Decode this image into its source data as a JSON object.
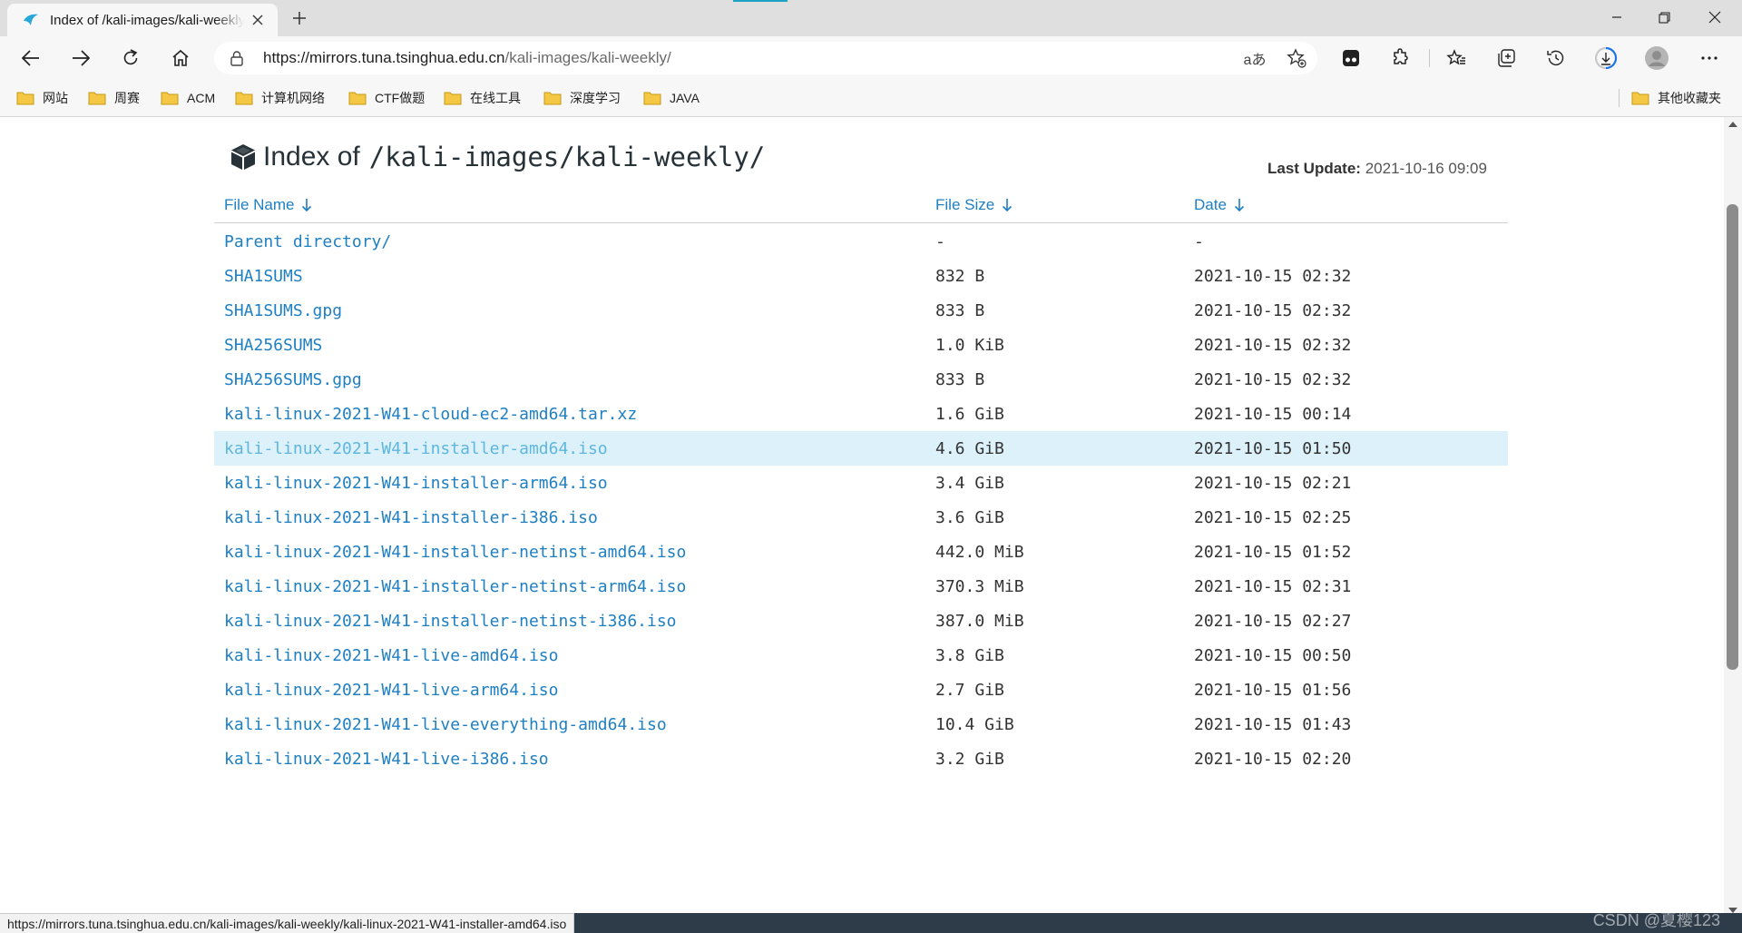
{
  "browser": {
    "tab": {
      "title": "Index of /kali-images/kali-weekly/"
    },
    "address": {
      "host": "https://mirrors.tuna.tsinghua.edu.cn",
      "path": "/kali-images/kali-weekly/"
    },
    "read_aloud_label": "aあ"
  },
  "bookmarks": {
    "items": [
      "网站",
      "周赛",
      "ACM",
      "计算机网络",
      "CTF做题",
      "在线工具",
      "深度学习",
      "JAVA"
    ],
    "other": "其他收藏夹"
  },
  "page": {
    "heading_prefix": "Index of",
    "heading_path": "/kali-images/kali-weekly/",
    "last_update_label": "Last Update:",
    "last_update_value": "2021-10-16 09:09",
    "columns": {
      "name": "File Name",
      "size": "File Size",
      "date": "Date"
    },
    "rows": [
      {
        "name": "Parent directory/",
        "size": "-",
        "date": "-"
      },
      {
        "name": "SHA1SUMS",
        "size": "832 B",
        "date": "2021-10-15 02:32"
      },
      {
        "name": "SHA1SUMS.gpg",
        "size": "833 B",
        "date": "2021-10-15 02:32"
      },
      {
        "name": "SHA256SUMS",
        "size": "1.0 KiB",
        "date": "2021-10-15 02:32"
      },
      {
        "name": "SHA256SUMS.gpg",
        "size": "833 B",
        "date": "2021-10-15 02:32"
      },
      {
        "name": "kali-linux-2021-W41-cloud-ec2-amd64.tar.xz",
        "size": "1.6 GiB",
        "date": "2021-10-15 00:14"
      },
      {
        "name": "kali-linux-2021-W41-installer-amd64.iso",
        "size": "4.6 GiB",
        "date": "2021-10-15 01:50",
        "hovered": true
      },
      {
        "name": "kali-linux-2021-W41-installer-arm64.iso",
        "size": "3.4 GiB",
        "date": "2021-10-15 02:21"
      },
      {
        "name": "kali-linux-2021-W41-installer-i386.iso",
        "size": "3.6 GiB",
        "date": "2021-10-15 02:25"
      },
      {
        "name": "kali-linux-2021-W41-installer-netinst-amd64.iso",
        "size": "442.0 MiB",
        "date": "2021-10-15 01:52"
      },
      {
        "name": "kali-linux-2021-W41-installer-netinst-arm64.iso",
        "size": "370.3 MiB",
        "date": "2021-10-15 02:31"
      },
      {
        "name": "kali-linux-2021-W41-installer-netinst-i386.iso",
        "size": "387.0 MiB",
        "date": "2021-10-15 02:27"
      },
      {
        "name": "kali-linux-2021-W41-live-amd64.iso",
        "size": "3.8 GiB",
        "date": "2021-10-15 00:50"
      },
      {
        "name": "kali-linux-2021-W41-live-arm64.iso",
        "size": "2.7 GiB",
        "date": "2021-10-15 01:56"
      },
      {
        "name": "kali-linux-2021-W41-live-everything-amd64.iso",
        "size": "10.4 GiB",
        "date": "2021-10-15 01:43"
      },
      {
        "name": "kali-linux-2021-W41-live-i386.iso",
        "size": "3.2 GiB",
        "date": "2021-10-15 02:20"
      }
    ]
  },
  "status": {
    "link_url": "https://mirrors.tuna.tsinghua.edu.cn/kali-images/kali-weekly/kali-linux-2021-W41-installer-amd64.iso",
    "watermark": "CSDN @夏樱123"
  },
  "colors": {
    "link": "#1e7fc3",
    "hover_row": "#ddf1fb",
    "hover_link": "#5eb6dd",
    "status_bar": "#2e3c4a",
    "heading": "#263238"
  },
  "icons": [
    "tab-favicon-icon",
    "close-icon",
    "plus-icon",
    "minimize-icon",
    "maximize-icon",
    "window-close-icon",
    "back-icon",
    "forward-icon",
    "refresh-icon",
    "home-icon",
    "lock-icon",
    "read-aloud-icon",
    "add-favorite-icon",
    "tampermonkey-icon",
    "extensions-icon",
    "favorites-icon",
    "collections-icon",
    "history-icon",
    "downloads-icon",
    "profile-icon",
    "more-icon",
    "folder-icon",
    "cube-icon",
    "sort-arrow-icon"
  ]
}
